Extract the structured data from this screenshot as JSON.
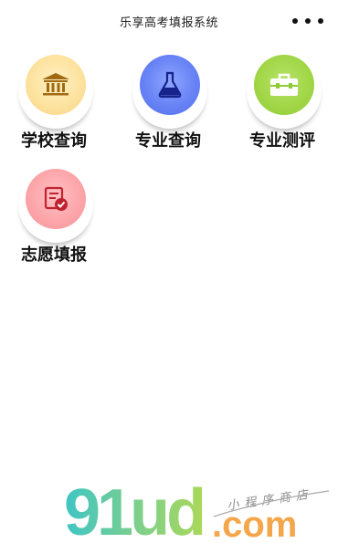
{
  "header": {
    "title": "乐享高考填报系统",
    "more_icon": "more-dots-icon"
  },
  "menu": {
    "items": [
      {
        "key": "school",
        "label": "学校查询",
        "icon": "museum-icon",
        "color": "#fde3a0"
      },
      {
        "key": "major",
        "label": "专业查询",
        "icon": "flask-icon",
        "color": "#6883f5"
      },
      {
        "key": "eval",
        "label": "专业测评",
        "icon": "toolbox-icon",
        "color": "#a2d748"
      },
      {
        "key": "wish",
        "label": "志愿填报",
        "icon": "form-check-icon",
        "color": "#fca6aa"
      }
    ]
  },
  "watermark": {
    "brand": "91ud",
    "domain": ".com",
    "slogan": "小程序商店"
  }
}
